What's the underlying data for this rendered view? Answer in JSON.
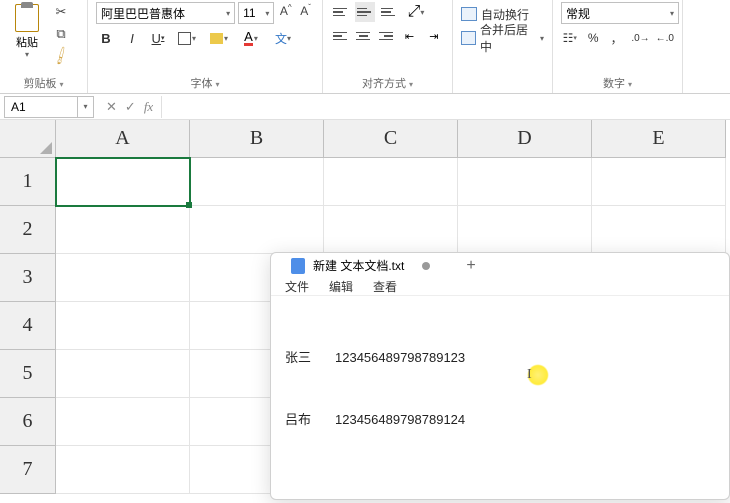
{
  "ribbon": {
    "clipboard": {
      "paste": "粘贴",
      "groupLabel": "剪贴板"
    },
    "font": {
      "name": "阿里巴巴普惠体",
      "size": "11",
      "bold": "B",
      "italic": "I",
      "underline": "U",
      "wen": "文",
      "groupLabel": "字体"
    },
    "align": {
      "wrap": "自动换行",
      "merge": "合并后居中",
      "groupLabel": "对齐方式"
    },
    "number": {
      "format": "常规",
      "percent": "%",
      "comma": "，",
      "groupLabel": "数字"
    }
  },
  "nameBox": "A1",
  "columns": [
    "A",
    "B",
    "C",
    "D",
    "E"
  ],
  "rows": [
    "1",
    "2",
    "3",
    "4",
    "5",
    "6",
    "7"
  ],
  "notepad": {
    "title": "新建 文本文档.txt",
    "menu": {
      "file": "文件",
      "edit": "编辑",
      "view": "查看"
    },
    "lines": [
      {
        "name": "张三",
        "num": "123456489798789123"
      },
      {
        "name": "吕布",
        "num": "123456489798789124"
      }
    ]
  }
}
